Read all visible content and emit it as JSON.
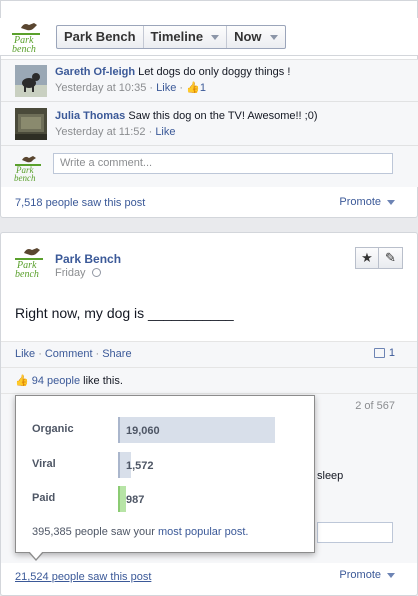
{
  "nav": {
    "items": [
      {
        "label": "Park Bench",
        "dropdown": false
      },
      {
        "label": "Timeline",
        "dropdown": true
      },
      {
        "label": "Now",
        "dropdown": true
      }
    ]
  },
  "logo_text": "Park bench",
  "post1": {
    "comments": [
      {
        "name": "Gareth Of-leigh",
        "text": "Let dogs do only doggy things !",
        "time": "Yesterday at 10:35",
        "like": "Like",
        "likes": "1"
      },
      {
        "name": "Julia Thomas",
        "text": "Saw this dog on the TV! Awesome!! ;0)",
        "time": "Yesterday at 11:52",
        "like": "Like"
      }
    ],
    "comment_placeholder": "Write a comment...",
    "reach_text": "7,518 people saw this post",
    "promote": "Promote"
  },
  "post2": {
    "page_name": "Park Bench",
    "time": "Friday",
    "message": "Right now, my dog is ___________",
    "actions": {
      "like": "Like",
      "comment": "Comment",
      "share": "Share",
      "separator": "·"
    },
    "comment_count": "1",
    "likes_count": "94 people",
    "likes_suffix": "like this.",
    "comments_pager": "2 of 567",
    "partial_comment_text": "sleep",
    "reach_text": "21,524 people saw this post",
    "promote": "Promote"
  },
  "reach_popup": {
    "rows": [
      {
        "label": "Organic",
        "value": "19,060",
        "fraction": 1.0,
        "color": "#d8dfea"
      },
      {
        "label": "Viral",
        "value": "1,572",
        "fraction": 0.082,
        "color": "#d8dfea"
      },
      {
        "label": "Paid",
        "value": "987",
        "fraction": 0.052,
        "color": "#b7e4a6"
      }
    ],
    "footer_prefix": "395,385 people saw your",
    "footer_link": "most popular post."
  },
  "colors": {
    "link": "#3b5998",
    "logo_green": "#5aa02c"
  }
}
